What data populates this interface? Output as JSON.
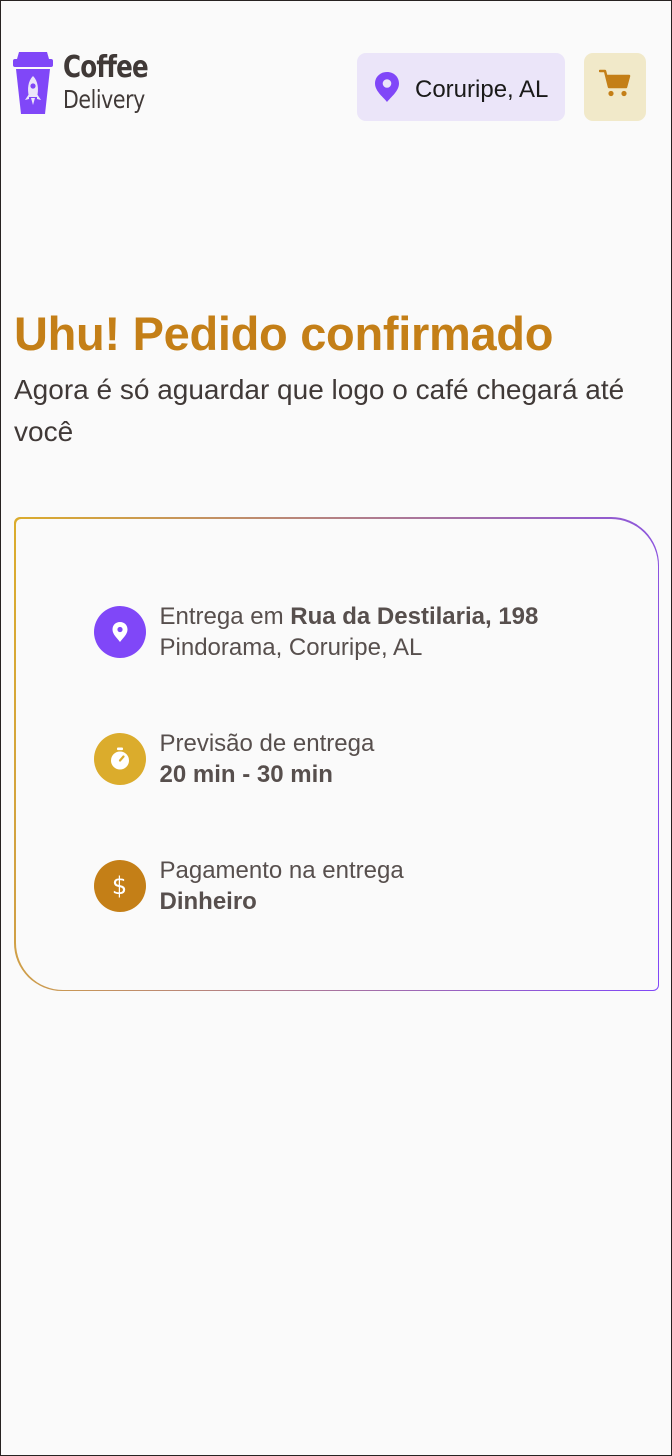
{
  "brand": {
    "line1": "Coffee",
    "line2": "Delivery",
    "icon": "rocket-cup-logo-icon"
  },
  "header": {
    "location": "Coruripe, AL",
    "location_icon": "map-pin-icon",
    "cart_icon": "shopping-cart-icon"
  },
  "confirmation": {
    "title": "Uhu! Pedido confirmado",
    "subtitle": "Agora é só aguardar que logo o café chegará até você"
  },
  "details": {
    "delivery": {
      "prefix": "Entrega em ",
      "street": "Rua da Destilaria, 198",
      "city": "Pindorama, Coruripe, AL",
      "icon": "map-pin-icon"
    },
    "estimate": {
      "label": "Previsão de entrega",
      "value": "20 min - 30 min",
      "icon": "timer-icon"
    },
    "payment": {
      "label": "Pagamento na entrega",
      "value": "Dinheiro",
      "icon": "currency-dollar-icon",
      "symbol": "$"
    }
  },
  "colors": {
    "purple": "#8047f8",
    "yellow": "#dbac2c",
    "yellow_dark": "#c47f17",
    "purple_light": "#ebe5f9",
    "yellow_light": "#f1e9c9",
    "text": "#403937"
  }
}
